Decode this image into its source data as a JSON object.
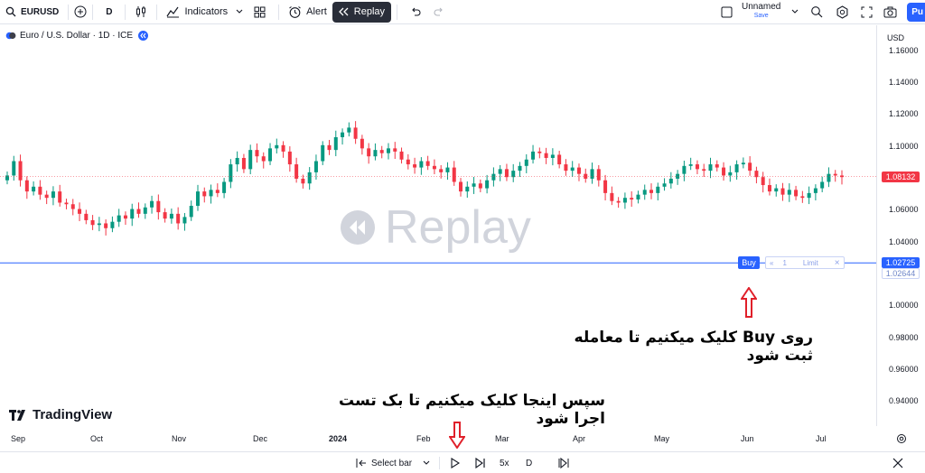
{
  "toolbar": {
    "symbol": "EURUSD",
    "interval": "D",
    "indicators_label": "Indicators",
    "alert_label": "Alert",
    "replay_label": "Replay",
    "layout_name": "Unnamed",
    "layout_status": "Save",
    "publish_label": "Pu"
  },
  "legend": {
    "title": "Euro / U.S. Dollar · 1D · ICE"
  },
  "price_axis": {
    "currency": "USD",
    "ticks": [
      "1.16000",
      "1.14000",
      "1.12000",
      "1.10000",
      "1.08000",
      "1.06000",
      "1.04000",
      "1.02000",
      "1.00000",
      "0.98000",
      "0.96000",
      "0.94000"
    ],
    "last_price": "1.08132",
    "order_price": "1.02725",
    "ask_price": "1.02644"
  },
  "time_axis": {
    "labels": [
      "Sep",
      "Oct",
      "Nov",
      "Dec",
      "2024",
      "Feb",
      "Mar",
      "Apr",
      "May",
      "Jun",
      "Jul"
    ]
  },
  "order_line": {
    "buy_label": "Buy",
    "quantity": "1",
    "type_label": "Limit",
    "close_label": "×"
  },
  "watermark": "Replay",
  "annotations": {
    "buy_instruction": "روی Buy کلیک میکنیم تا معامله ثبت شود",
    "play_instruction": "سپس اینجا کلیک میکنیم تا بک تست اجرا شود"
  },
  "branding": {
    "logo_text": "TradingView"
  },
  "bottom_bar": {
    "select_bar_label": "Select bar",
    "speed": "5x",
    "interval": "D"
  },
  "colors": {
    "up": "#089981",
    "down": "#f23645",
    "accent": "#2962ff",
    "annotation_arrow": "#e0202a"
  },
  "chart_data": {
    "type": "candlestick",
    "x_labels": [
      "Sep",
      "Oct",
      "Nov",
      "Dec",
      "2024",
      "Feb",
      "Mar",
      "Apr",
      "May",
      "Jun",
      "Jul"
    ],
    "closes": [
      1.082,
      1.091,
      1.079,
      1.072,
      1.075,
      1.07,
      1.068,
      1.072,
      1.065,
      1.064,
      1.061,
      1.058,
      1.054,
      1.051,
      1.052,
      1.049,
      1.053,
      1.057,
      1.055,
      1.061,
      1.058,
      1.062,
      1.066,
      1.059,
      1.055,
      1.058,
      1.052,
      1.056,
      1.063,
      1.072,
      1.069,
      1.073,
      1.071,
      1.078,
      1.089,
      1.093,
      1.086,
      1.098,
      1.094,
      1.091,
      1.099,
      1.101,
      1.097,
      1.089,
      1.08,
      1.077,
      1.084,
      1.091,
      1.101,
      1.098,
      1.106,
      1.109,
      1.112,
      1.105,
      1.099,
      1.094,
      1.098,
      1.096,
      1.099,
      1.097,
      1.092,
      1.089,
      1.087,
      1.091,
      1.088,
      1.086,
      1.084,
      1.087,
      1.078,
      1.072,
      1.075,
      1.077,
      1.074,
      1.079,
      1.083,
      1.086,
      1.081,
      1.085,
      1.088,
      1.092,
      1.097,
      1.096,
      1.093,
      1.095,
      1.089,
      1.085,
      1.087,
      1.083,
      1.08,
      1.086,
      1.079,
      1.071,
      1.066,
      1.065,
      1.068,
      1.067,
      1.07,
      1.073,
      1.071,
      1.075,
      1.077,
      1.08,
      1.083,
      1.088,
      1.089,
      1.086,
      1.085,
      1.089,
      1.087,
      1.082,
      1.084,
      1.089,
      1.09,
      1.085,
      1.081,
      1.076,
      1.072,
      1.074,
      1.07,
      1.073,
      1.069,
      1.068,
      1.071,
      1.074,
      1.078,
      1.083,
      1.082,
      1.081
    ],
    "ylim": [
      0.925,
      1.175
    ],
    "last_price": 1.08132,
    "order_price": 1.02725
  }
}
